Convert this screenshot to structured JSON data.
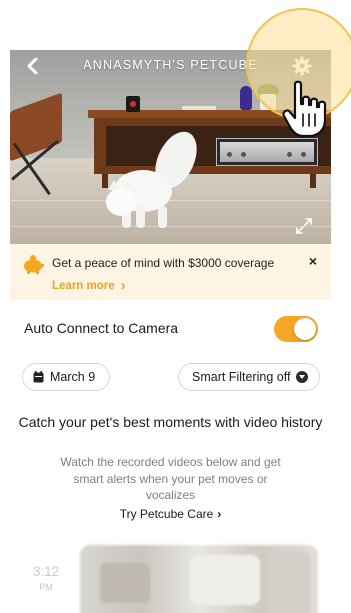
{
  "feed": {
    "title": "ANNASMYTH'S PETCUBE",
    "back_icon": "chevron-left-icon",
    "settings_icon": "gear-icon",
    "expand_icon": "expand-icon"
  },
  "banner": {
    "icon": "piggy-bank-icon",
    "text": "Get a peace of mind with $3000 coverage",
    "link_label": "Learn more",
    "link_chevron": "›",
    "close_label": "×",
    "accent": "#f0a21a",
    "background": "#fdf4e3"
  },
  "auto_connect": {
    "label": "Auto Connect to Camera",
    "enabled": true,
    "toggle_color": "#f5a623"
  },
  "filters": {
    "date_label": "March 9",
    "date_icon": "calendar-icon",
    "smart_filter_label": "Smart Filtering off",
    "smart_filter_icon": "chevron-down-icon"
  },
  "promo": {
    "title": "Catch your pet's best moments with video history",
    "body": "Watch the recorded videos below and get smart alerts when your pet moves or vocalizes",
    "link_label": "Try Petcube Care",
    "link_chevron": "›"
  },
  "video_history": {
    "items": [
      {
        "time": "3:12",
        "ampm": "PM"
      }
    ]
  },
  "overlay": {
    "hand_icon": "pointer-hand-icon",
    "highlight_color": "#f3c350"
  }
}
